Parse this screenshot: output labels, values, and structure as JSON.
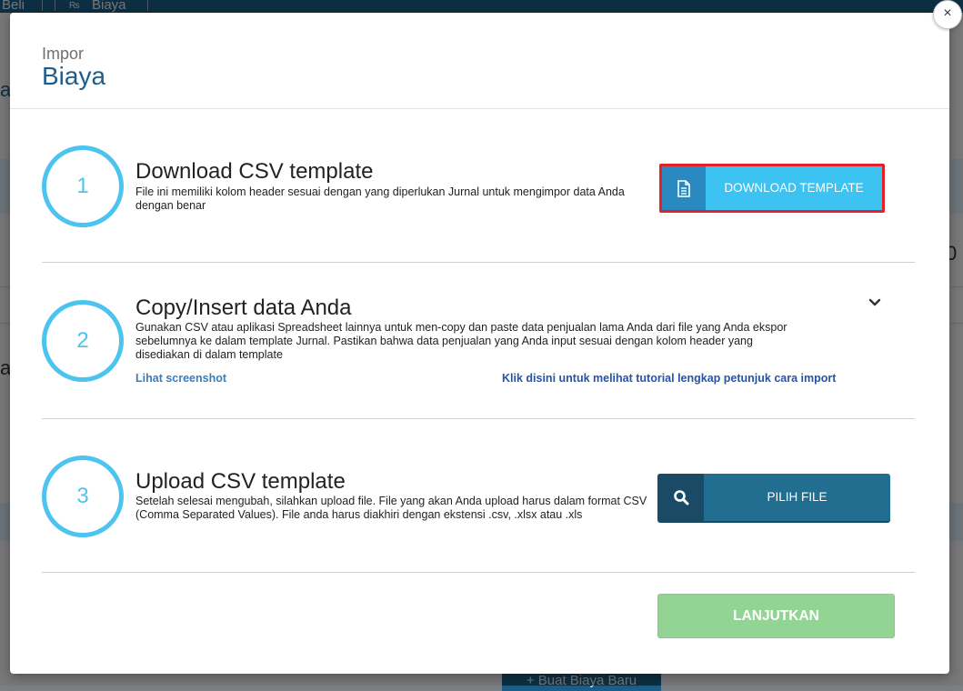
{
  "background": {
    "topbar_beli": "Beli",
    "topbar_biaya": "Biaya",
    "bottom_button": "+ Buat Biaya Baru"
  },
  "modal": {
    "subtitle": "Impor",
    "title": "Biaya",
    "close_label": "×"
  },
  "steps": [
    {
      "number": "1",
      "title": "Download CSV template",
      "description": "File ini memiliki kolom header sesuai dengan yang diperlukan Jurnal untuk mengimpor data Anda dengan benar",
      "button_label": "DOWNLOAD TEMPLATE",
      "button_icon": "document-icon"
    },
    {
      "number": "2",
      "title": "Copy/Insert data Anda",
      "description": "Gunakan CSV atau aplikasi Spreadsheet lainnya untuk men-copy dan paste data penjualan lama Anda dari file yang Anda ekspor sebelumnya ke dalam template Jurnal. Pastikan bahwa data penjualan yang Anda input sesuai dengan kolom header yang disediakan di dalam template",
      "link_screenshot": "Lihat screenshot",
      "link_tutorial": "Klik disini untuk melihat tutorial lengkap petunjuk cara import",
      "toggle_icon": "chevron-down-icon"
    },
    {
      "number": "3",
      "title": "Upload CSV template",
      "description": "Setelah selesai mengubah, silahkan upload file. File yang akan Anda upload harus dalam format CSV (Comma Separated Values). File anda harus diakhiri dengan ekstensi .csv, .xlsx atau .xls",
      "button_label": "PILIH FILE",
      "button_icon": "search-icon"
    }
  ],
  "footer": {
    "continue_label": "LANJUTKAN"
  },
  "colors": {
    "accent_blue": "#4dc4ef",
    "title_blue": "#1f5e8c",
    "download_button": "#3cc3f2",
    "highlight_border": "#e3212b",
    "pilih_button": "#226e90",
    "continue_button_disabled": "#93d494"
  }
}
